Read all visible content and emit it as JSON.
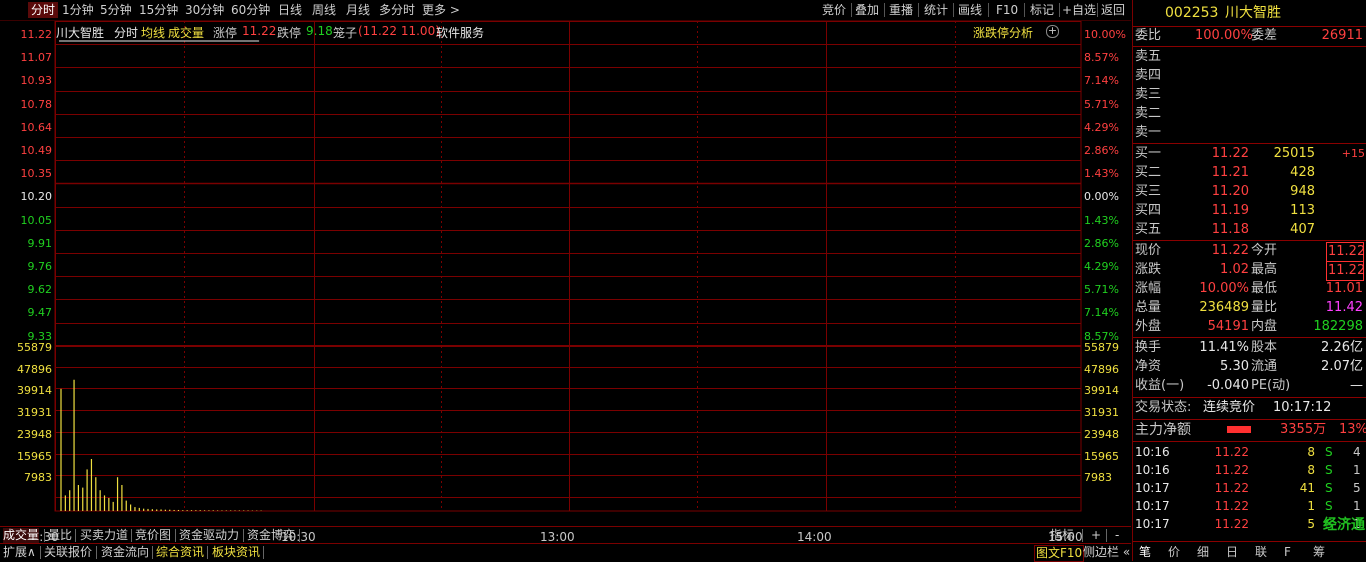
{
  "toolbar": {
    "left_items": [
      "分时",
      "1分钟",
      "5分钟",
      "15分钟",
      "30分钟",
      "60分钟",
      "日线",
      "周线",
      "月线",
      "多分时",
      "更多 >"
    ],
    "right_items": [
      "竞价",
      "叠加",
      "重播",
      "统计",
      "画线",
      "F10",
      "标记",
      "+自选",
      "返回"
    ]
  },
  "chart_header": {
    "name": "川大智胜",
    "mode": "分时",
    "avg_label": "均线",
    "vol_label": "成交量",
    "limit_up_label": "涨停",
    "limit_up_value": "11.22",
    "limit_down_label": "跌停",
    "limit_down_value": "9.18",
    "cage_label": "笼子",
    "cage_value": "(11.22 11.00)",
    "service_label": "软件服务",
    "analysis_label": "涨跌停分析"
  },
  "price_axis_left": [
    "11.22",
    "11.07",
    "10.93",
    "10.78",
    "10.64",
    "10.49",
    "10.35",
    "10.20",
    "10.05",
    "9.91",
    "9.76",
    "9.62",
    "9.47",
    "9.33"
  ],
  "price_axis_right": [
    "10.00%",
    "8.57%",
    "7.14%",
    "5.71%",
    "4.29%",
    "2.86%",
    "1.43%",
    "0.00%",
    "1.43%",
    "2.86%",
    "4.29%",
    "5.71%",
    "7.14%",
    "8.57%"
  ],
  "volume_axis": [
    "55879",
    "47896",
    "39914",
    "31931",
    "23948",
    "15965",
    "7983"
  ],
  "time_axis": [
    "09:30",
    "10:30",
    "13:00",
    "14:00",
    "15:00"
  ],
  "chart_data": {
    "type": "bar",
    "price_range": [
      9.18,
      11.22
    ],
    "prev_close": 10.2,
    "volume_range": [
      0,
      63862
    ],
    "price_line": {
      "name": "价格",
      "value": 11.22
    },
    "volume_bars_first_minutes": [
      47000,
      6000,
      8000,
      50500,
      10000,
      9000,
      16000,
      20000,
      13000,
      8000,
      6000,
      5000,
      3500,
      13000,
      10000,
      4000,
      2500,
      1500,
      1200,
      900,
      800,
      700,
      600,
      600,
      500,
      500,
      400,
      400,
      300,
      300,
      300,
      300,
      300,
      250,
      250,
      250,
      200,
      200,
      200,
      200,
      200,
      200,
      200,
      200,
      150,
      150,
      150
    ]
  },
  "bottom_tabs": [
    "成交量",
    "量比",
    "买卖力道",
    "竞价图",
    "资金驱动力",
    "资金博弈"
  ],
  "bottom_right": [
    "指标",
    "+",
    "-"
  ],
  "bottom_tabs2": [
    "扩展∧",
    "关联报价",
    "资金流向",
    "综合资讯",
    "板块资讯"
  ],
  "bottom_right2": "图文F10",
  "side_toggle": "侧边栏 «",
  "quote": {
    "code": "002253",
    "name": "川大智胜",
    "weibi_label": "委比",
    "weibi": "100.00%",
    "weicha_label": "委差",
    "weicha": "26911",
    "sell_labels": [
      "卖五",
      "卖四",
      "卖三",
      "卖二",
      "卖一"
    ],
    "buy": [
      {
        "label": "买一",
        "price": "11.22",
        "vol": "25015",
        "chg": "+15"
      },
      {
        "label": "买二",
        "price": "11.21",
        "vol": "428",
        "chg": ""
      },
      {
        "label": "买三",
        "price": "11.20",
        "vol": "948",
        "chg": ""
      },
      {
        "label": "买四",
        "price": "11.19",
        "vol": "113",
        "chg": ""
      },
      {
        "label": "买五",
        "price": "11.18",
        "vol": "407",
        "chg": ""
      }
    ],
    "stats": [
      {
        "l1": "现价",
        "v1": "11.22",
        "l2": "今开",
        "v2": "11.22"
      },
      {
        "l1": "涨跌",
        "v1": "1.02",
        "l2": "最高",
        "v2": "11.22"
      },
      {
        "l1": "涨幅",
        "v1": "10.00%",
        "l2": "最低",
        "v2": "11.01"
      },
      {
        "l1": "总量",
        "v1": "236489",
        "l2": "量比",
        "v2": "11.42"
      },
      {
        "l1": "外盘",
        "v1": "54191",
        "l2": "内盘",
        "v2": "182298"
      }
    ],
    "stats2": [
      {
        "l1": "换手",
        "v1": "11.41%",
        "l2": "股本",
        "v2": "2.26亿"
      },
      {
        "l1": "净资",
        "v1": "5.30",
        "l2": "流通",
        "v2": "2.07亿"
      },
      {
        "l1": "收益(一)",
        "v1": "-0.040",
        "l2": "PE(动)",
        "v2": "—"
      }
    ],
    "trade_status_label": "交易状态:",
    "trade_status": "连续竞价",
    "trade_time": "10:17:12",
    "main_net_label": "主力净额",
    "main_net_value": "3355万",
    "main_net_pct": "13%",
    "ticks": [
      {
        "t": "10:16",
        "p": "11.22",
        "v": "8",
        "s": "S",
        "n": "4"
      },
      {
        "t": "10:16",
        "p": "11.22",
        "v": "8",
        "s": "S",
        "n": "1"
      },
      {
        "t": "10:17",
        "p": "11.22",
        "v": "41",
        "s": "S",
        "n": "5"
      },
      {
        "t": "10:17",
        "p": "11.22",
        "v": "1",
        "s": "S",
        "n": "1"
      },
      {
        "t": "10:17",
        "p": "11.22",
        "v": "5",
        "s": "S",
        "n": "1"
      }
    ],
    "bottom_tabs": [
      "笔",
      "价",
      "细",
      "日",
      "联",
      "F",
      "筹"
    ],
    "watermark": "经济通"
  },
  "colors": {
    "grid": "#7a0000",
    "price_red": "#ff4040",
    "price_green": "#20d020",
    "volume": "#f0e040"
  }
}
